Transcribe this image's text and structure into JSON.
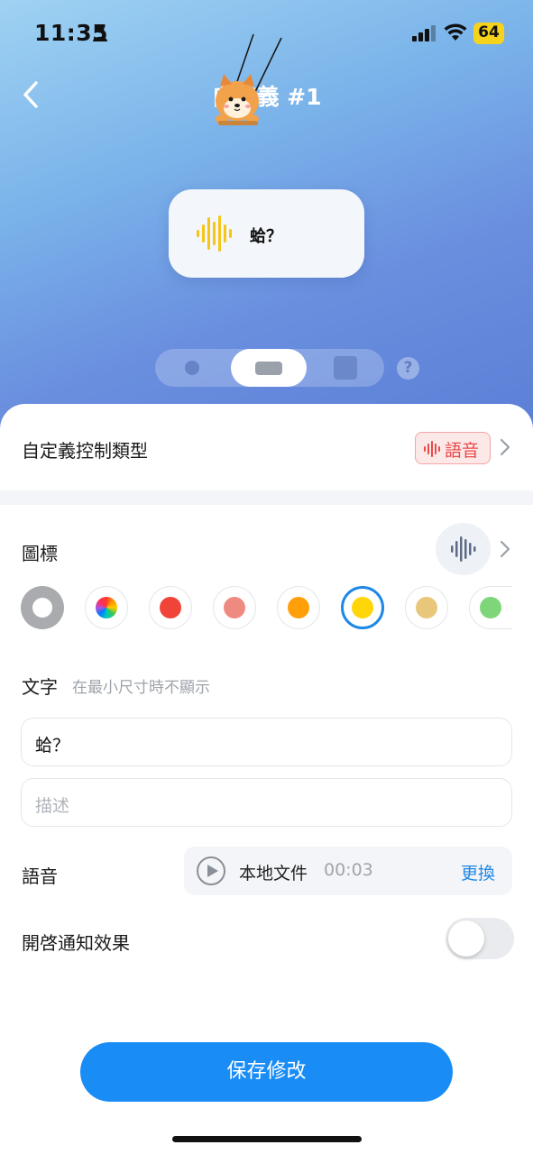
{
  "status_bar": {
    "time": "11:35",
    "battery": "64"
  },
  "nav": {
    "title": "自定義 #1"
  },
  "preview": {
    "text": "蛤？"
  },
  "control_type": {
    "label": "自定義控制類型",
    "badge": "語音"
  },
  "icon_section": {
    "label": "圖標",
    "icon": "voice-wave-icon"
  },
  "colors": {
    "options": [
      "#a9abae",
      "rainbow",
      "#f04438",
      "#ef8a80",
      "#ff9f0a",
      "#ffd60a",
      "#e8c77a",
      "#7fd67a"
    ],
    "selected_index": 5
  },
  "text_section": {
    "label": "文字",
    "hint": "在最小尺寸時不顯示"
  },
  "text_input": {
    "value": "蛤？"
  },
  "description_input": {
    "placeholder": "描述"
  },
  "voice": {
    "label": "語音",
    "source": "本地文件",
    "duration": "00:03",
    "change": "更換"
  },
  "notification": {
    "label": "開啓通知效果",
    "enabled": false
  },
  "save_button": {
    "label": "保存修改"
  }
}
